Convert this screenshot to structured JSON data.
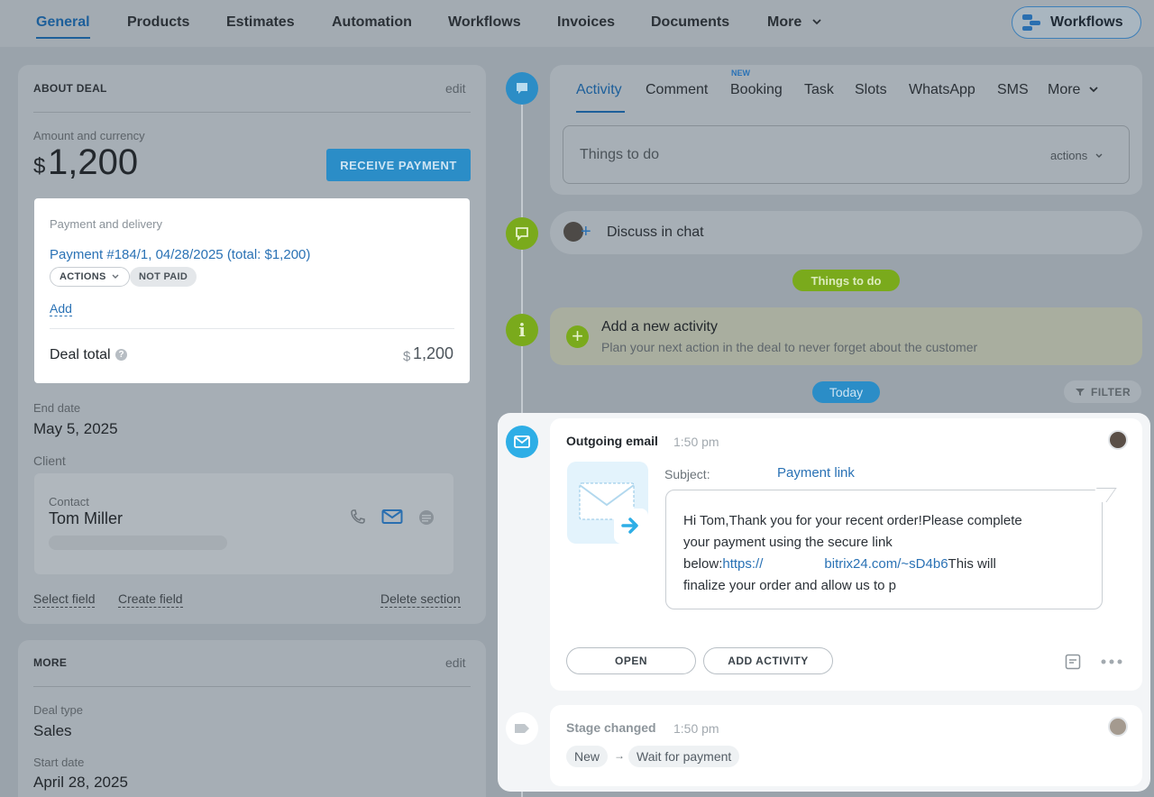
{
  "nav": {
    "tabs": [
      "General",
      "Products",
      "Estimates",
      "Automation",
      "Workflows",
      "Invoices",
      "Documents",
      "More"
    ],
    "workflows_button": "Workflows"
  },
  "about_deal": {
    "title": "ABOUT DEAL",
    "edit": "edit",
    "amount_label": "Amount and currency",
    "currency": "$",
    "amount": "1,200",
    "receive_payment": "RECEIVE PAYMENT",
    "payment_delivery_label": "Payment and delivery",
    "payment_link": "Payment #184/1, 04/28/2025 (total: $1,200)",
    "actions_pill": "ACTIONS",
    "not_paid_pill": "NOT PAID",
    "add_link": "Add",
    "deal_total_label": "Deal total",
    "deal_total_currency": "$",
    "deal_total_value": "1,200",
    "end_date_label": "End date",
    "end_date": "May 5, 2025",
    "client_label": "Client",
    "contact_label": "Contact",
    "contact_name": "Tom Miller",
    "select_field": "Select field",
    "create_field": "Create field",
    "delete_section": "Delete section"
  },
  "more_section": {
    "title": "MORE",
    "edit": "edit",
    "deal_type_label": "Deal type",
    "deal_type": "Sales",
    "start_date_label": "Start date",
    "start_date": "April 28, 2025"
  },
  "activity": {
    "tabs": [
      "Activity",
      "Comment",
      "Booking",
      "Task",
      "Slots",
      "WhatsApp",
      "SMS",
      "More"
    ],
    "new_badge": "NEW",
    "input_placeholder": "Things to do",
    "actions": "actions",
    "discuss_chat": "Discuss in chat",
    "things_to_do_badge": "Things to do",
    "add_activity_title": "Add a new activity",
    "add_activity_sub": "Plan your next action in the deal to never forget about the customer",
    "today_badge": "Today",
    "filter": "FILTER"
  },
  "email": {
    "title": "Outgoing email",
    "time": "1:50 pm",
    "subject_label": "Subject:",
    "subject": "Payment link",
    "body_1": "Hi Tom,Thank you for your recent order!Please complete",
    "body_2": "your payment using the secure link",
    "body_3_prefix": "below:",
    "body_link_a": "https://",
    "body_link_b": "bitrix24.com/~sD4b6",
    "body_3_suffix": "This will",
    "body_4": "finalize your order and allow us to p",
    "open": "OPEN",
    "add_activity": "ADD ACTIVITY"
  },
  "stage": {
    "title": "Stage changed",
    "time": "1:50 pm",
    "from": "New",
    "arrow": "→",
    "to": "Wait for payment"
  }
}
